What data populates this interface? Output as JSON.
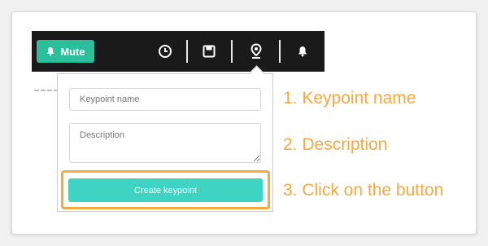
{
  "toolbar": {
    "mute_label": "Mute",
    "icons": [
      "bell-icon",
      "clock-icon",
      "save-icon",
      "location-pin-icon",
      "bell-icon"
    ]
  },
  "keypoint_form": {
    "name_placeholder": "Keypoint name",
    "description_placeholder": "Description",
    "create_button_label": "Create keypoint"
  },
  "steps": [
    "1. Keypoint name",
    "2. Description",
    "3. Click on the button"
  ],
  "colors": {
    "accent_green": "#2bbf9b",
    "button_teal": "#3fd3c1",
    "annotation_orange": "#f5a940",
    "toolbar_bg": "#1a1a1a"
  }
}
